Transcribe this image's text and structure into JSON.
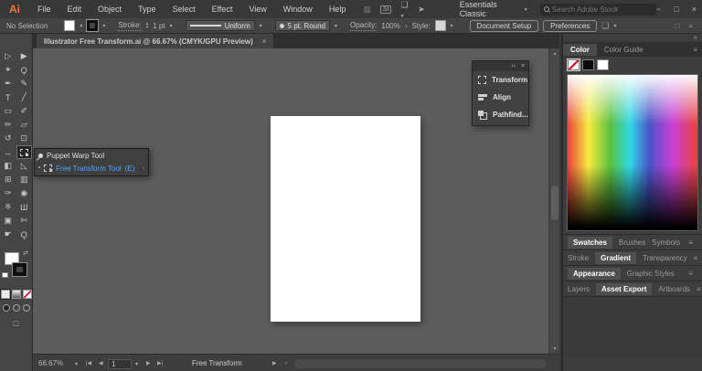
{
  "titlebar": {
    "logo": "Ai",
    "menus": [
      "File",
      "Edit",
      "Object",
      "Type",
      "Select",
      "Effect",
      "View",
      "Window",
      "Help"
    ],
    "stock_icon": "St",
    "workspace": "Essentials Classic",
    "search_placeholder": "Search Adobe Stock"
  },
  "options": {
    "no_selection": "No Selection",
    "stroke_label": "Stroke:",
    "stroke_value": "1 pt",
    "variable_width": "Uniform",
    "brush": "5 pt. Round",
    "opacity_label": "Opacity:",
    "opacity_value": "100%",
    "style_label": "Style:",
    "document_setup": "Document Setup",
    "preferences": "Preferences"
  },
  "doc_tab": {
    "title": "Illustrator Free Transform.ai @ 66.67% (CMYK/GPU Preview)"
  },
  "tools": [
    {
      "name": "selection-tool",
      "g": "▷"
    },
    {
      "name": "direct-selection-tool",
      "g": "▶"
    },
    {
      "name": "magic-wand-tool",
      "g": "✶"
    },
    {
      "name": "lasso-tool",
      "g": "Ϙ"
    },
    {
      "name": "pen-tool",
      "g": "✒"
    },
    {
      "name": "curvature-tool",
      "g": "✎"
    },
    {
      "name": "type-tool",
      "g": "T"
    },
    {
      "name": "line-segment-tool",
      "g": "╱"
    },
    {
      "name": "rectangle-tool",
      "g": "▭"
    },
    {
      "name": "paintbrush-tool",
      "g": "✐"
    },
    {
      "name": "pencil-tool",
      "g": "✏"
    },
    {
      "name": "eraser-tool",
      "g": "▱"
    },
    {
      "name": "rotate-tool",
      "g": "↺"
    },
    {
      "name": "scale-tool",
      "g": "⊡"
    },
    {
      "name": "width-tool",
      "g": "↔"
    },
    {
      "name": "free-transform-tool",
      "g": ""
    },
    {
      "name": "shape-builder-tool",
      "g": "◧"
    },
    {
      "name": "perspective-grid-tool",
      "g": "◺"
    },
    {
      "name": "mesh-tool",
      "g": "⊞"
    },
    {
      "name": "gradient-tool",
      "g": "▥"
    },
    {
      "name": "eyedropper-tool",
      "g": "✑"
    },
    {
      "name": "blend-tool",
      "g": "◉"
    },
    {
      "name": "symbol-sprayer-tool",
      "g": "※"
    },
    {
      "name": "graph-tool",
      "g": "Ш"
    },
    {
      "name": "artboard-tool",
      "g": "▣"
    },
    {
      "name": "slice-tool",
      "g": "✄"
    },
    {
      "name": "hand-tool",
      "g": "☛"
    },
    {
      "name": "zoom-tool",
      "g": "Ǫ"
    }
  ],
  "flyout": {
    "item1": "Puppet Warp Tool",
    "item2": "Free Transform Tool",
    "shortcut2": "(E)"
  },
  "float_panel": {
    "items": [
      "Transform",
      "Align",
      "Pathfind..."
    ]
  },
  "right_panel": {
    "tabs": [
      "Color",
      "Color Guide"
    ],
    "row1": [
      "Swatches",
      "Brushes",
      "Symbols"
    ],
    "row2": [
      "Stroke",
      "Gradient",
      "Transparency"
    ],
    "row3": [
      "Appearance",
      "Graphic Styles"
    ],
    "row4": [
      "Layers",
      "Asset Export",
      "Artboards"
    ]
  },
  "statusbar": {
    "zoom": "66.67%",
    "page": "1",
    "tool": "Free Transform"
  },
  "icons": {
    "chevron_down": "▾",
    "chevron_up": "▴",
    "chevron_right": "›",
    "chevron_left": "‹",
    "minimize": "−",
    "restore": "□",
    "close": "×",
    "menu": "≡",
    "collapse": "»",
    "panel_collapse": "››",
    "first_page": "|◀",
    "prev_page": "◀",
    "next_page": "▶",
    "last_page": "▶|",
    "separator_play": "▶",
    "share": "➤",
    "grid": "▦",
    "workspace": "❏",
    "swap": "⇄",
    "bullet": "▪"
  },
  "colors": {
    "accent_blue": "#4DA3FF",
    "logo_orange": "#F0703E",
    "canvas_gray": "#5C5C5C",
    "artboard_white": "#FFFFFF"
  }
}
